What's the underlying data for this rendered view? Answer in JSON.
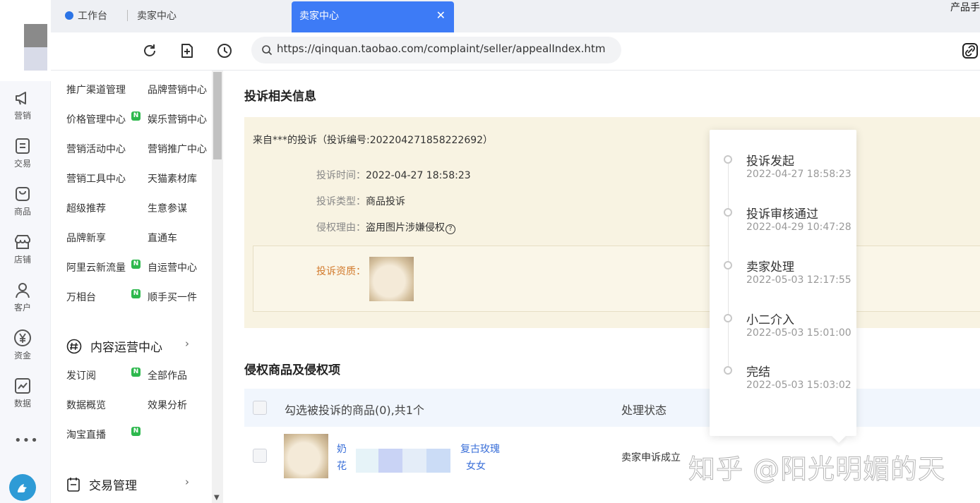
{
  "tabs": {
    "workbench": "工作台",
    "seller_center": "卖家中心",
    "active": "卖家中心",
    "active_close": "✕",
    "corner": "产品手"
  },
  "toolbar": {
    "url": "https://qinquan.taobao.com/complaint/seller/appealIndex.htm"
  },
  "rail": {
    "items": [
      {
        "label": "营销",
        "icon": "megaphone-icon"
      },
      {
        "label": "交易",
        "icon": "list-icon"
      },
      {
        "label": "商品",
        "icon": "bag-icon"
      },
      {
        "label": "店铺",
        "icon": "store-icon"
      },
      {
        "label": "客户",
        "icon": "person-icon"
      },
      {
        "label": "资金",
        "icon": "yen-icon"
      },
      {
        "label": "数据",
        "icon": "chart-icon"
      }
    ],
    "more": "•••"
  },
  "menu": {
    "grid": [
      {
        "left": "推广渠道管理",
        "right": "品牌营销中心",
        "left_badge": false
      },
      {
        "left": "价格管理中心",
        "right": "娱乐营销中心",
        "left_badge": true
      },
      {
        "left": "营销活动中心",
        "right": "营销推广中心",
        "left_badge": false
      },
      {
        "left": "营销工具中心",
        "right": "天猫素材库",
        "left_badge": false
      },
      {
        "left": "超级推荐",
        "right": "生意参谋",
        "left_badge": false
      },
      {
        "left": "品牌新享",
        "right": "直通车",
        "left_badge": false
      },
      {
        "left": "阿里云新流量",
        "right": "自运营中心",
        "left_badge": true
      },
      {
        "left": "万相台",
        "right": "顺手买一件",
        "left_badge": true
      }
    ],
    "badge": "N",
    "content_center": {
      "title": "内容运营中心",
      "chevron": "›",
      "items": [
        {
          "left": "发订阅",
          "right": "全部作品",
          "left_badge": true
        },
        {
          "left": "数据概览",
          "right": "效果分析",
          "left_badge": false
        },
        {
          "left": "淘宝直播",
          "right": "",
          "left_badge": true
        }
      ]
    },
    "trade": {
      "title": "交易管理",
      "chevron": "›"
    }
  },
  "complaint": {
    "section_title": "投诉相关信息",
    "from_line": "来自***的投诉（投诉编号:202204271858222692）",
    "time_label": "投诉时间：",
    "time_value": "2022-04-27 18:58:23",
    "type_label": "投诉类型：",
    "type_value": "商品投诉",
    "reason_label": "侵权理由：",
    "reason_value": "盗用图片涉嫌侵权",
    "reason_help": "?",
    "qual_label": "投诉资质："
  },
  "timeline": [
    {
      "title": "投诉发起",
      "time": "2022-04-27 18:58:23"
    },
    {
      "title": "投诉审核通过",
      "time": "2022-04-29 10:47:28"
    },
    {
      "title": "卖家处理",
      "time": "2022-05-03 12:17:55"
    },
    {
      "title": "小二介入",
      "time": "2022-05-03 15:01:00"
    },
    {
      "title": "完结",
      "time": "2022-05-03 15:03:02"
    }
  ],
  "goods": {
    "section_title": "侵权商品及侵权项",
    "select_header": "勾选被投诉的商品(0),共1个",
    "status_header": "处理状态",
    "row": {
      "title_part1": "奶",
      "title_part2": "花",
      "title_part3": "复古玫瑰",
      "title_part4": "女女",
      "status": "卖家申诉成立"
    }
  },
  "watermark": "知乎 @阳光明媚的天",
  "colors": {
    "accent": "#3d7bf6",
    "badge": "#2db84d",
    "info_bg": "#f8f3e2",
    "link": "#3a6fd8"
  }
}
